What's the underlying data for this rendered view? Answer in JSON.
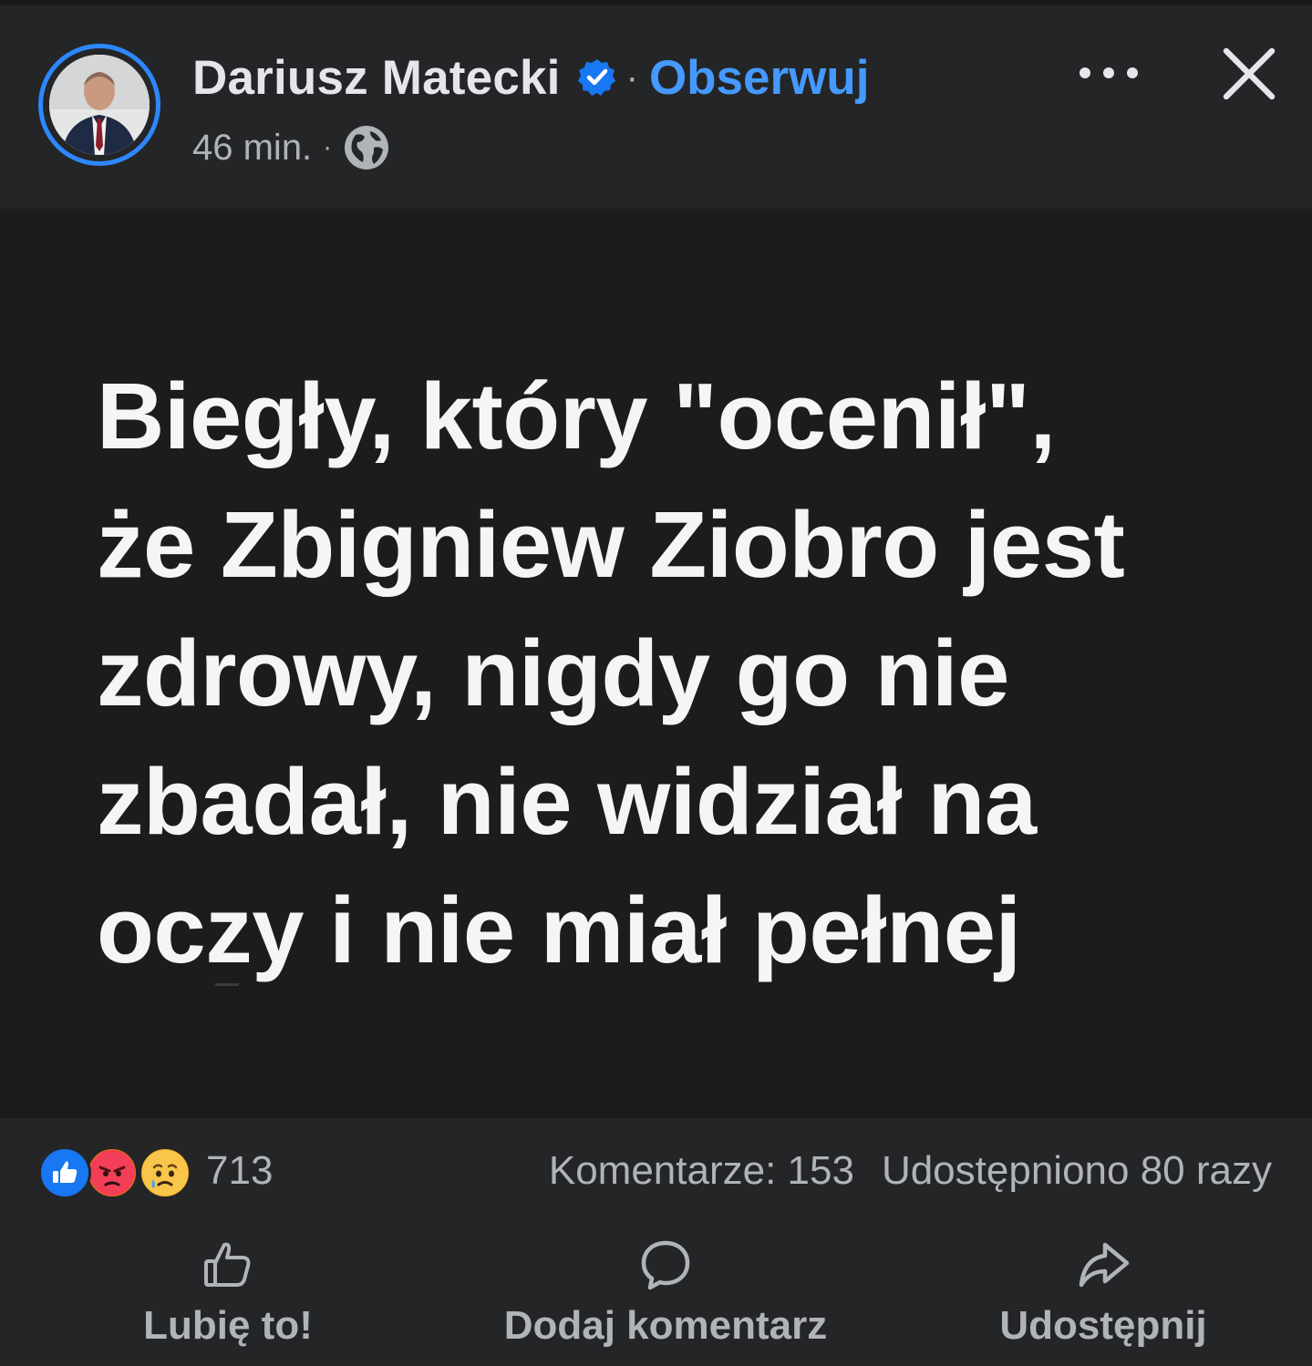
{
  "author": {
    "name": "Dariusz Matecki",
    "verified_icon": "verified-badge-icon",
    "separator": "·",
    "follow_label": "Obserwuj"
  },
  "meta": {
    "time": "46 min.",
    "separator": "·",
    "audience_icon": "globe-icon"
  },
  "header_actions": {
    "more_icon": "more-options-icon",
    "close_icon": "close-icon"
  },
  "post": {
    "lines": [
      "Biegły, który \"ocenił\",",
      "że Zbigniew Ziobro jest",
      "zdrowy, nigdy go nie",
      "zbadał, nie widział na",
      "oczy i nie miał pełnej"
    ]
  },
  "reactions": {
    "icons": [
      "like-reaction-icon",
      "angry-reaction-icon",
      "sad-reaction-icon"
    ],
    "count": "713",
    "comments": "Komentarze: 153",
    "shares": "Udostępniono 80 razy"
  },
  "actions": {
    "like": "Lubię to!",
    "comment": "Dodaj komentarz",
    "share": "Udostępnij"
  },
  "colors": {
    "background": "#242526",
    "image_background": "#1c1c1d",
    "accent": "#4599ff",
    "secondary_text": "#b0b3b8"
  }
}
